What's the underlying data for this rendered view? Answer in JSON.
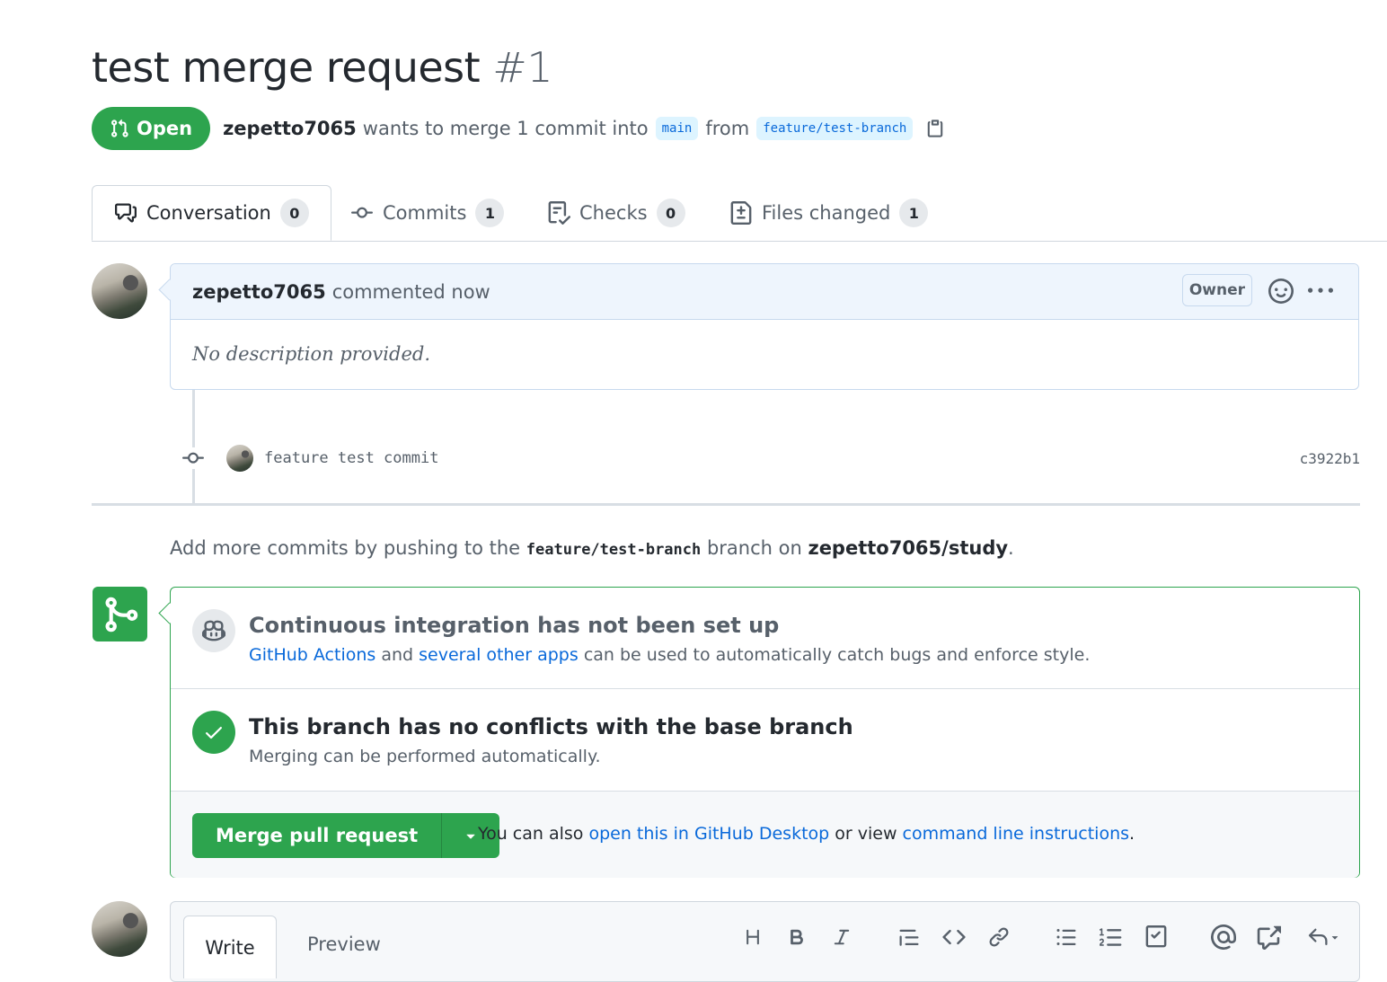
{
  "header": {
    "title": "test merge request",
    "number": "#1",
    "state": "Open",
    "author": "zepetto7065",
    "merge_text": "wants to merge 1 commit into",
    "base_branch": "main",
    "from_text": "from",
    "head_branch": "feature/test-branch"
  },
  "tabs": [
    {
      "label": "Conversation",
      "count": "0"
    },
    {
      "label": "Commits",
      "count": "1"
    },
    {
      "label": "Checks",
      "count": "0"
    },
    {
      "label": "Files changed",
      "count": "1"
    }
  ],
  "comment": {
    "author": "zepetto7065",
    "action": "commented now",
    "badge": "Owner",
    "body": "No description provided."
  },
  "commit": {
    "message": "feature test commit",
    "sha": "c3922b1"
  },
  "hint": {
    "prefix": "Add more commits by pushing to the",
    "branch": "feature/test-branch",
    "middle": "branch on",
    "repo": "zepetto7065/study",
    "suffix": "."
  },
  "merge_box": {
    "ci_title": "Continuous integration has not been set up",
    "ci_link1": "GitHub Actions",
    "ci_and": "and",
    "ci_link2": "several other apps",
    "ci_rest": "can be used to automatically catch bugs and enforce style.",
    "conflict_title": "This branch has no conflicts with the base branch",
    "conflict_sub": "Merging can be performed automatically.",
    "merge_button": "Merge pull request",
    "foot_prefix": "You can also",
    "foot_link1": "open this in GitHub Desktop",
    "foot_middle": "or view",
    "foot_link2": "command line instructions",
    "foot_suffix": "."
  },
  "editor": {
    "write_tab": "Write",
    "preview_tab": "Preview",
    "tools": [
      "heading-icon",
      "bold-icon",
      "italic-icon",
      "quote-icon",
      "code-icon",
      "link-icon",
      "unordered-list-icon",
      "ordered-list-icon",
      "task-list-icon",
      "mention-icon",
      "cross-reference-icon",
      "reply-icon"
    ]
  },
  "colors": {
    "green": "#2da44e",
    "link": "#0969da",
    "muted": "#57606a",
    "text": "#24292f"
  }
}
